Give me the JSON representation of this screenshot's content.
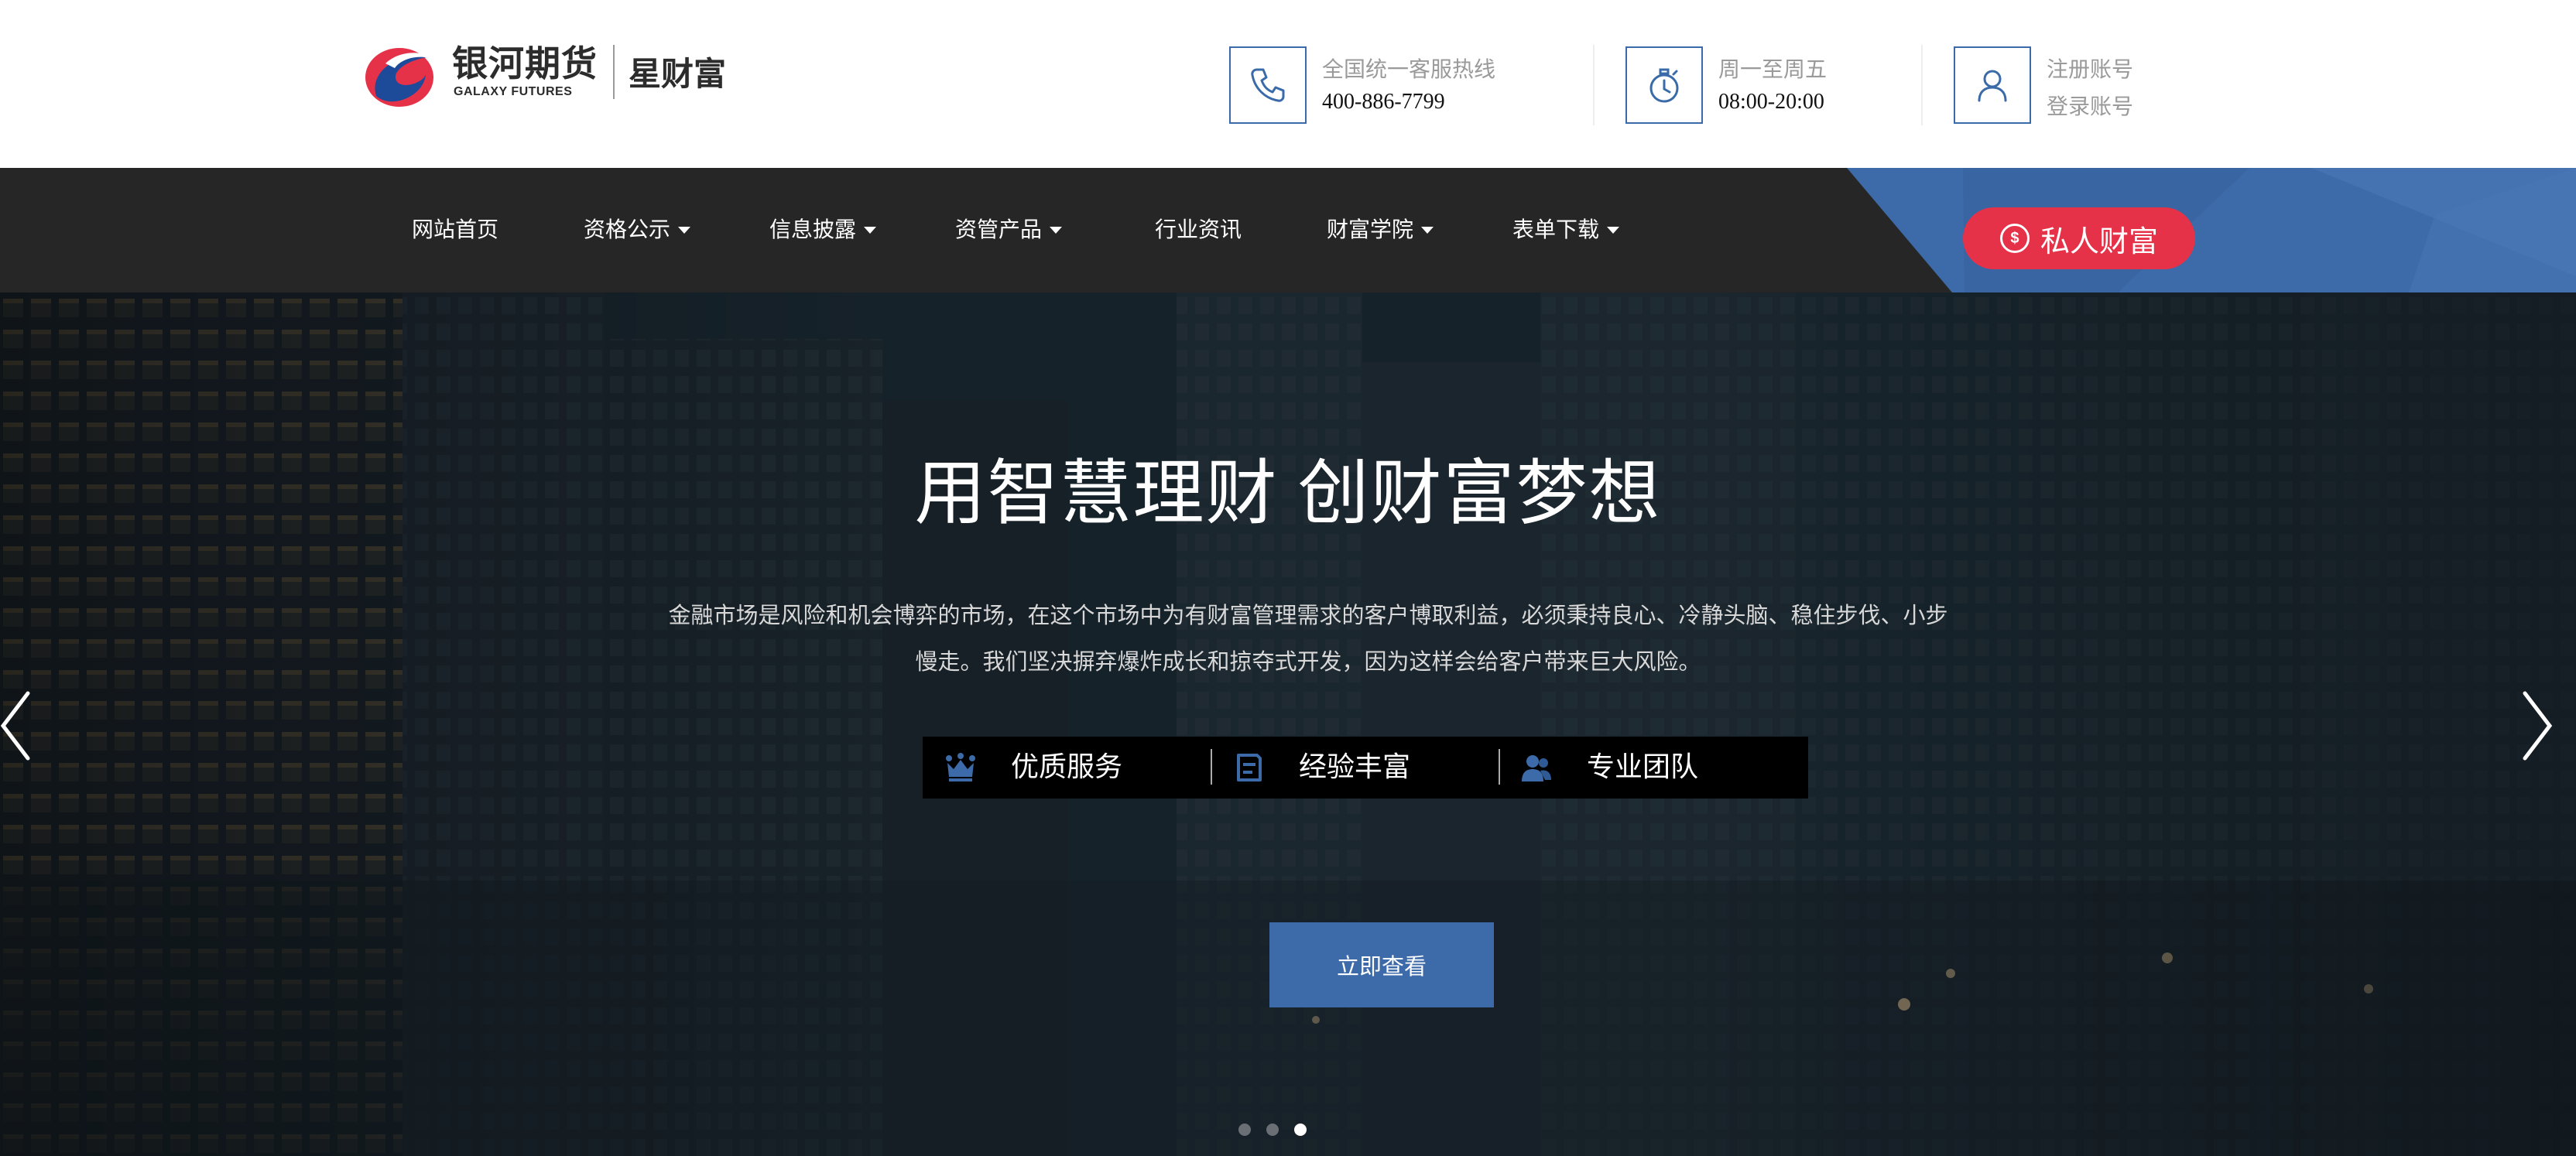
{
  "brand": {
    "name_cn": "银河期货",
    "name_en": "GALAXY FUTURES",
    "product": "星财富",
    "colors": {
      "red": "#e63248",
      "blue": "#3d6aa8",
      "nav_bg": "#262626"
    }
  },
  "header": {
    "hotline": {
      "icon": "phone-icon",
      "label": "全国统一客服热线",
      "value": "400-886-7799"
    },
    "hours": {
      "icon": "stopwatch-icon",
      "label": "周一至周五",
      "value": "08:00-20:00"
    },
    "account": {
      "icon": "user-icon",
      "register": "注册账号",
      "login": "登录账号"
    }
  },
  "nav": {
    "items": [
      {
        "label": "网站首页",
        "dropdown": false
      },
      {
        "label": "资格公示",
        "dropdown": true
      },
      {
        "label": "信息披露",
        "dropdown": true
      },
      {
        "label": "资管产品",
        "dropdown": true
      },
      {
        "label": "行业资讯",
        "dropdown": false
      },
      {
        "label": "财富学院",
        "dropdown": true
      },
      {
        "label": "表单下载",
        "dropdown": true
      }
    ],
    "private_wealth": {
      "icon": "dollar-coin-icon",
      "label": "私人财富"
    }
  },
  "hero": {
    "title": "用智慧理财 创财富梦想",
    "description": "金融市场是风险和机会博弈的市场，在这个市场中为有财富管理需求的客户博取利益，必须秉持良心、冷静头脑、稳住步伐、小步慢走。我们坚决摒弃爆炸成长和掠夺式开发，因为这样会给客户带来巨大风险。",
    "features": [
      {
        "icon": "crown-icon",
        "label": "优质服务"
      },
      {
        "icon": "document-icon",
        "label": "经验丰富"
      },
      {
        "icon": "team-icon",
        "label": "专业团队"
      }
    ],
    "cta_label": "立即查看",
    "slides": {
      "count": 3,
      "active_index": 3
    }
  }
}
